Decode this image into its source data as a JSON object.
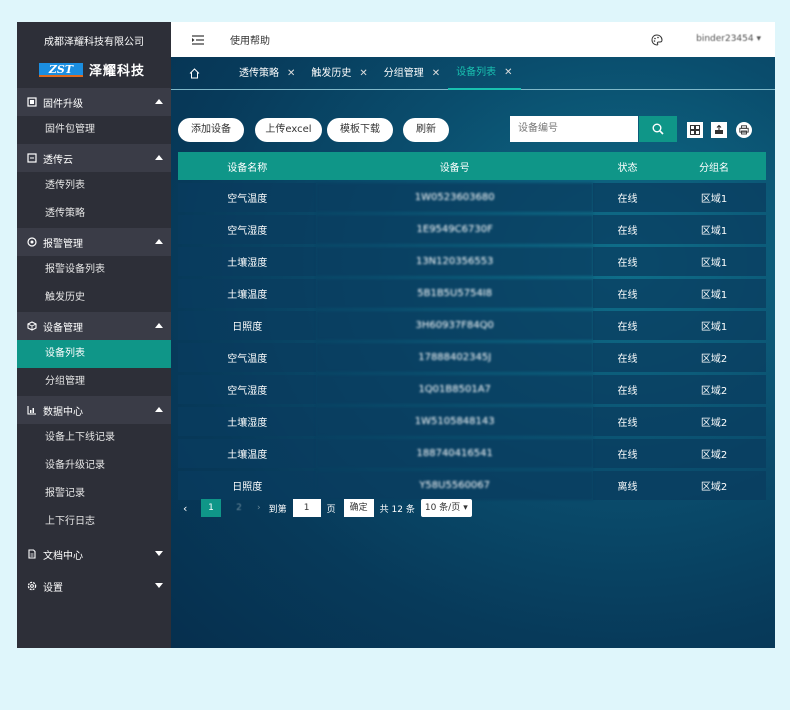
{
  "sidebar": {
    "company": "成都泽耀科技有限公司",
    "logo_mark": "ZST",
    "logo_name": "泽耀科技",
    "groups": [
      {
        "label": "固件升级",
        "icon": "firmware-icon",
        "expanded": true,
        "items": [
          "固件包管理"
        ]
      },
      {
        "label": "透传云",
        "icon": "cloud-icon",
        "expanded": true,
        "items": [
          "透传列表",
          "透传策略"
        ]
      },
      {
        "label": "报警管理",
        "icon": "alarm-icon",
        "expanded": true,
        "items": [
          "报警设备列表",
          "触发历史"
        ]
      },
      {
        "label": "设备管理",
        "icon": "device-icon",
        "expanded": true,
        "items": [
          "设备列表",
          "分组管理"
        ]
      },
      {
        "label": "数据中心",
        "icon": "chart-icon",
        "expanded": true,
        "items": [
          "设备上下线记录",
          "设备升级记录",
          "报警记录",
          "上下行日志"
        ]
      },
      {
        "label": "文档中心",
        "icon": "document-icon",
        "expanded": false,
        "items": []
      },
      {
        "label": "设置",
        "icon": "gear-icon",
        "expanded": false,
        "items": []
      }
    ],
    "active_item": "设备列表",
    "accent": "#0f9688"
  },
  "topbar": {
    "menu_icon": "menu-fold-icon",
    "help_label": "使用帮助",
    "username": "binder23454"
  },
  "tabs": [
    {
      "label": "透传策略",
      "active": false
    },
    {
      "label": "触发历史",
      "active": false
    },
    {
      "label": "分组管理",
      "active": false
    },
    {
      "label": "设备列表",
      "active": true
    }
  ],
  "toolbar": {
    "add_label": "添加设备",
    "upload_label": "上传excel",
    "template_label": "模板下载",
    "refresh_label": "刷新",
    "search_placeholder": "设备编号"
  },
  "table": {
    "headers": [
      "设备名称",
      "设备号",
      "状态",
      "分组名"
    ],
    "rows": [
      [
        "空气温度",
        "1W0523603680",
        "在线",
        "区域1"
      ],
      [
        "空气湿度",
        "1E9549C6730F",
        "在线",
        "区域1"
      ],
      [
        "土壤湿度",
        "13N120356553",
        "在线",
        "区域1"
      ],
      [
        "土壤温度",
        "5B1B5U5754I8",
        "在线",
        "区域1"
      ],
      [
        "日照度",
        "3H60937F84Q0",
        "在线",
        "区域1"
      ],
      [
        "空气温度",
        "17888402345J",
        "在线",
        "区域2"
      ],
      [
        "空气湿度",
        "1Q01B8501A7",
        "在线",
        "区域2"
      ],
      [
        "土壤湿度",
        "1W5105848143",
        "在线",
        "区域2"
      ],
      [
        "土壤温度",
        "188740416541",
        "在线",
        "区域2"
      ],
      [
        "日照度",
        "Y58U5560067",
        "离线",
        "区域2"
      ]
    ]
  },
  "pager": {
    "current": "1",
    "ghost": "2",
    "goto_label": "到第",
    "goto_value": "1",
    "page_unit": "页",
    "confirm_label": "确定",
    "total_label": "共 12 条",
    "size_label": "10 条/页"
  }
}
